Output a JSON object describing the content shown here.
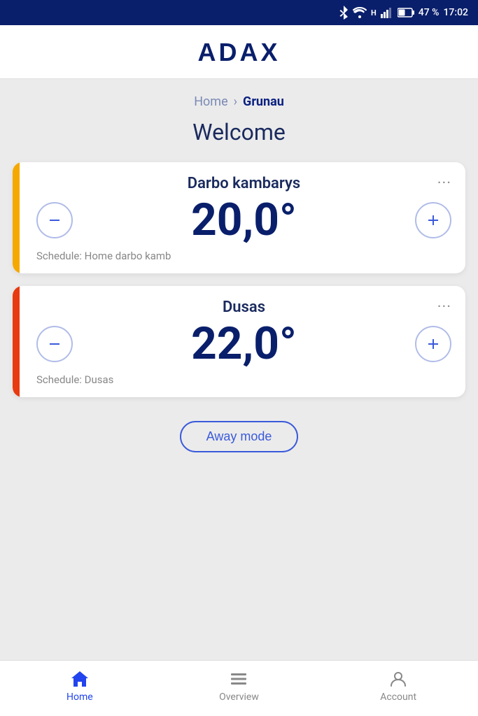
{
  "status_bar": {
    "battery": "47 %",
    "time": "17:02"
  },
  "header": {
    "logo": "ADAX"
  },
  "breadcrumb": {
    "home_label": "Home",
    "current_label": "Grunau"
  },
  "main": {
    "welcome": "Welcome",
    "cards": [
      {
        "id": "darbo",
        "name": "Darbo kambarys",
        "temperature": "20,0°",
        "schedule": "Schedule: Home darbo kamb",
        "accent_color": "#f5a800"
      },
      {
        "id": "dusas",
        "name": "Dusas",
        "temperature": "22,0°",
        "schedule": "Schedule: Dusas",
        "accent_color": "#e83a10"
      }
    ],
    "away_mode_label": "Away mode"
  },
  "bottom_nav": {
    "items": [
      {
        "id": "home",
        "label": "Home",
        "active": true
      },
      {
        "id": "overview",
        "label": "Overview",
        "active": false
      },
      {
        "id": "account",
        "label": "Account",
        "active": false
      }
    ]
  }
}
